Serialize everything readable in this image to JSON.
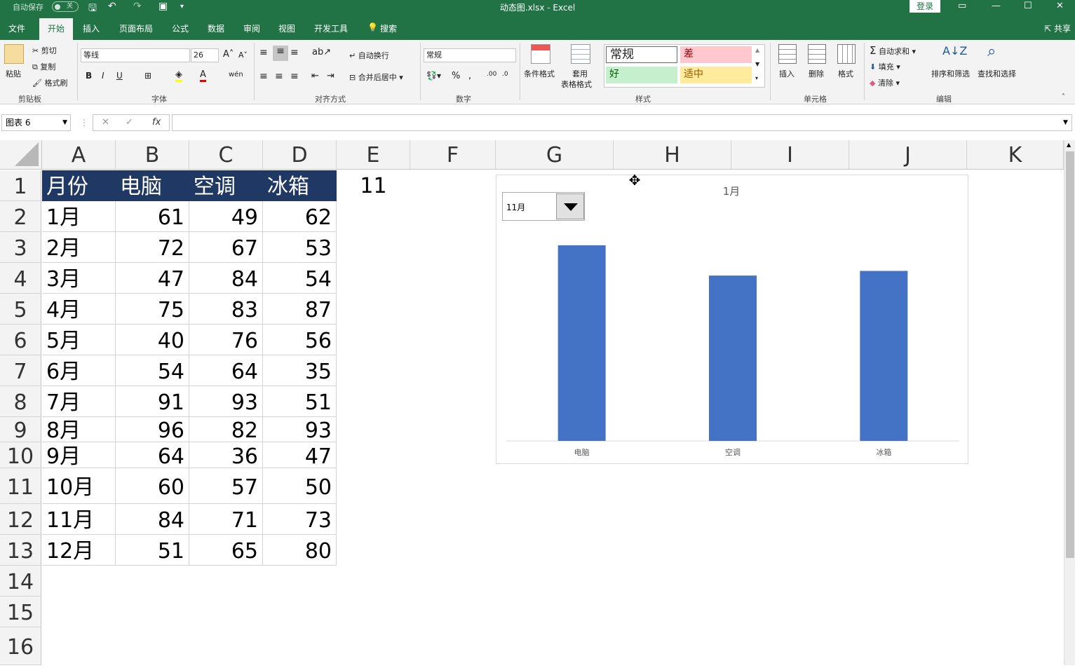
{
  "titlebar": {
    "autosave_label": "自动保存",
    "autosave_state": "关",
    "doc_title": "动态图.xlsx  -  Excel",
    "login": "登录"
  },
  "tabs": [
    "文件",
    "开始",
    "插入",
    "页面布局",
    "公式",
    "数据",
    "审阅",
    "视图",
    "开发工具",
    "搜索"
  ],
  "active_tab": "开始",
  "share_label": "共享",
  "ribbon": {
    "clipboard": {
      "paste": "粘贴",
      "cut": "剪切",
      "copy": "复制",
      "format_painter": "格式刷",
      "label": "剪贴板"
    },
    "font": {
      "name": "等线",
      "size": "26",
      "label": "字体"
    },
    "alignment": {
      "wrap": "自动换行",
      "merge": "合并后居中",
      "label": "对齐方式"
    },
    "number": {
      "format": "常规",
      "label": "数字"
    },
    "styles": {
      "conditional": "条件格式",
      "table_1": "套用",
      "table_2": "表格格式",
      "normal": "常规",
      "bad": "差",
      "good": "好",
      "neutral": "适中",
      "label": "样式"
    },
    "cells": {
      "insert": "插入",
      "delete": "删除",
      "format": "格式",
      "label": "单元格"
    },
    "editing": {
      "autosum": "自动求和",
      "fill": "填充",
      "clear": "清除",
      "sort": "排序和筛选",
      "find": "查找和选择",
      "label": "编辑"
    }
  },
  "formula_bar": {
    "name_box": "图表 6",
    "formula": ""
  },
  "columns": [
    "A",
    "B",
    "C",
    "D",
    "E",
    "F",
    "G",
    "H",
    "I",
    "J",
    "K"
  ],
  "rows": [
    "1",
    "2",
    "3",
    "4",
    "5",
    "6",
    "7",
    "8",
    "9",
    "10",
    "11",
    "12",
    "13",
    "14",
    "15",
    "16"
  ],
  "table": {
    "header": [
      "月份",
      "电脑",
      "空调",
      "冰箱"
    ],
    "data": [
      [
        "1月",
        "61",
        "49",
        "62"
      ],
      [
        "2月",
        "72",
        "67",
        "53"
      ],
      [
        "3月",
        "47",
        "84",
        "54"
      ],
      [
        "4月",
        "75",
        "83",
        "87"
      ],
      [
        "5月",
        "40",
        "76",
        "56"
      ],
      [
        "6月",
        "54",
        "64",
        "35"
      ],
      [
        "7月",
        "91",
        "93",
        "51"
      ],
      [
        "8月",
        "96",
        "82",
        "93"
      ],
      [
        "9月",
        "64",
        "36",
        "47"
      ],
      [
        "10月",
        "60",
        "57",
        "50"
      ],
      [
        "11月",
        "84",
        "71",
        "73"
      ],
      [
        "12月",
        "51",
        "65",
        "80"
      ]
    ]
  },
  "cell_e1": "11",
  "chart": {
    "dropdown_value": "11月"
  },
  "chart_data": {
    "type": "bar",
    "title": "1月",
    "categories": [
      "电脑",
      "空调",
      "冰箱"
    ],
    "values": [
      84,
      71,
      73
    ],
    "ylim": [
      0,
      90
    ],
    "color": "#4472c4",
    "grid": false
  }
}
